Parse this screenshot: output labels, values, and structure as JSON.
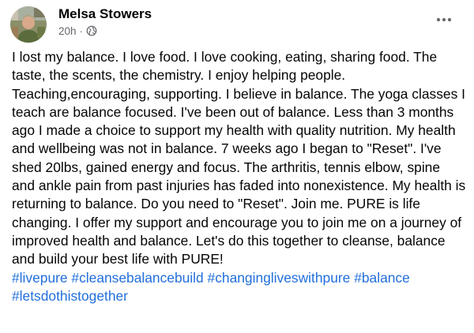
{
  "post": {
    "author": {
      "name": "Melsa Stowers"
    },
    "timestamp": "20h",
    "separator": "·",
    "audience_icon": "globe-icon",
    "more_icon": "more-horizontal-icon",
    "body_text": "I lost my balance. I love food. I love cooking, eating, sharing food. The taste, the scents, the chemistry. I enjoy helping people. Teaching,encouraging, supporting. I believe in balance. The yoga classes I teach are balance focused. I've been out of balance. Less than 3 months ago I made a choice to support my health with quality nutrition. My health and wellbeing was not in balance. 7 weeks ago I began to \"Reset\". I've shed 20lbs, gained energy and focus. The arthritis, tennis elbow, spine and ankle pain from past injuries has faded into nonexistence. My health is returning to balance. Do you need to \"Reset\". Join me. PURE is life changing. I offer my support and encourage you to join me on a journey of improved health and balance. Let's do this together to cleanse, balance and build your best life with PURE!",
    "hashtags": [
      "#livepure",
      "#cleansebalancebuild",
      "#changinglives­withpure",
      "#balance",
      "#letsdothistogether"
    ]
  },
  "colors": {
    "text": "#050505",
    "secondary_text": "#65676b",
    "hashtag": "#216fdb"
  }
}
